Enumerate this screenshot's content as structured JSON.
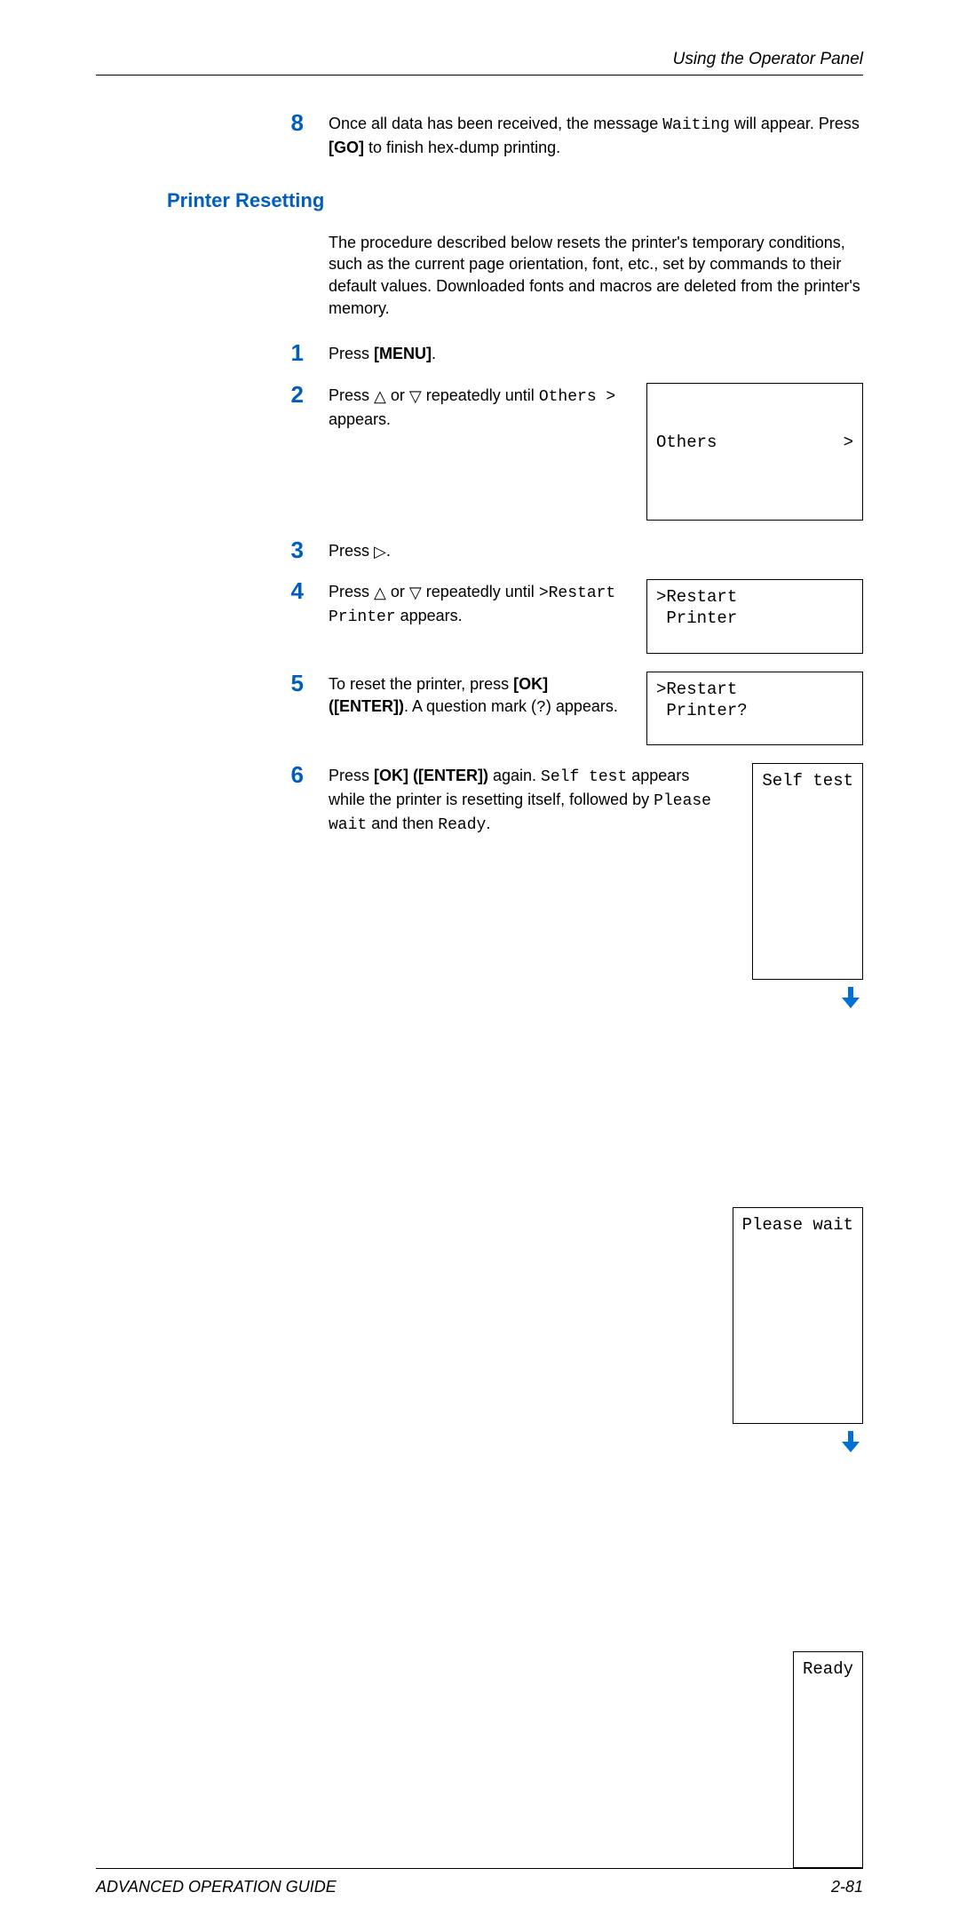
{
  "header": {
    "section": "Using the Operator Panel"
  },
  "step8": {
    "num": "8",
    "text_before": "Once all data has been received, the message ",
    "msg_waiting": "Waiting",
    "text_mid": " will appear. Press ",
    "key_go": "[GO]",
    "text_after": " to finish hex-dump printing."
  },
  "section_title": "Printer Resetting",
  "intro": "The procedure described below resets the printer's temporary conditions, such as the current page orientation, font, etc., set by commands to their default values. Downloaded fonts and macros are deleted from the printer's memory.",
  "step1": {
    "num": "1",
    "t1": "Press ",
    "key_menu": "[MENU]",
    "t2": "."
  },
  "step2": {
    "num": "2",
    "t1": "Press ",
    "up": "△",
    "t2": " or ",
    "down": "▽",
    "t3": " repeatedly until ",
    "mono": "Others >",
    "t4": " appears.",
    "lcd_left": "Others",
    "lcd_right": ">"
  },
  "step3": {
    "num": "3",
    "t1": "Press ",
    "right": "▷",
    "t2": "."
  },
  "step4": {
    "num": "4",
    "t1": "Press ",
    "up": "△",
    "t2": " or ",
    "down": "▽",
    "t3": " repeatedly until ",
    "mono": ">Restart Printer",
    "t4": " appears.",
    "lcd": ">Restart\n Printer"
  },
  "step5": {
    "num": "5",
    "t1": "To reset the printer, press ",
    "key_ok": "[OK] ([ENTER])",
    "t2": ". A question mark (",
    "qmark": "?",
    "t3": ") appears.",
    "lcd": ">Restart\n Printer?"
  },
  "step6": {
    "num": "6",
    "t1": "Press ",
    "key_ok": "[OK] ([ENTER])",
    "t2": " again. ",
    "mono1": "Self test",
    "t3": " appears while the printer is resetting itself, followed by ",
    "mono2": "Please wait",
    "t4": " and then ",
    "mono3": "Ready",
    "t5": ".",
    "lcd1": "Self test",
    "lcd2": "Please wait",
    "lcd3": "Ready"
  },
  "footer": {
    "left": "ADVANCED OPERATION GUIDE",
    "right": "2-81"
  }
}
